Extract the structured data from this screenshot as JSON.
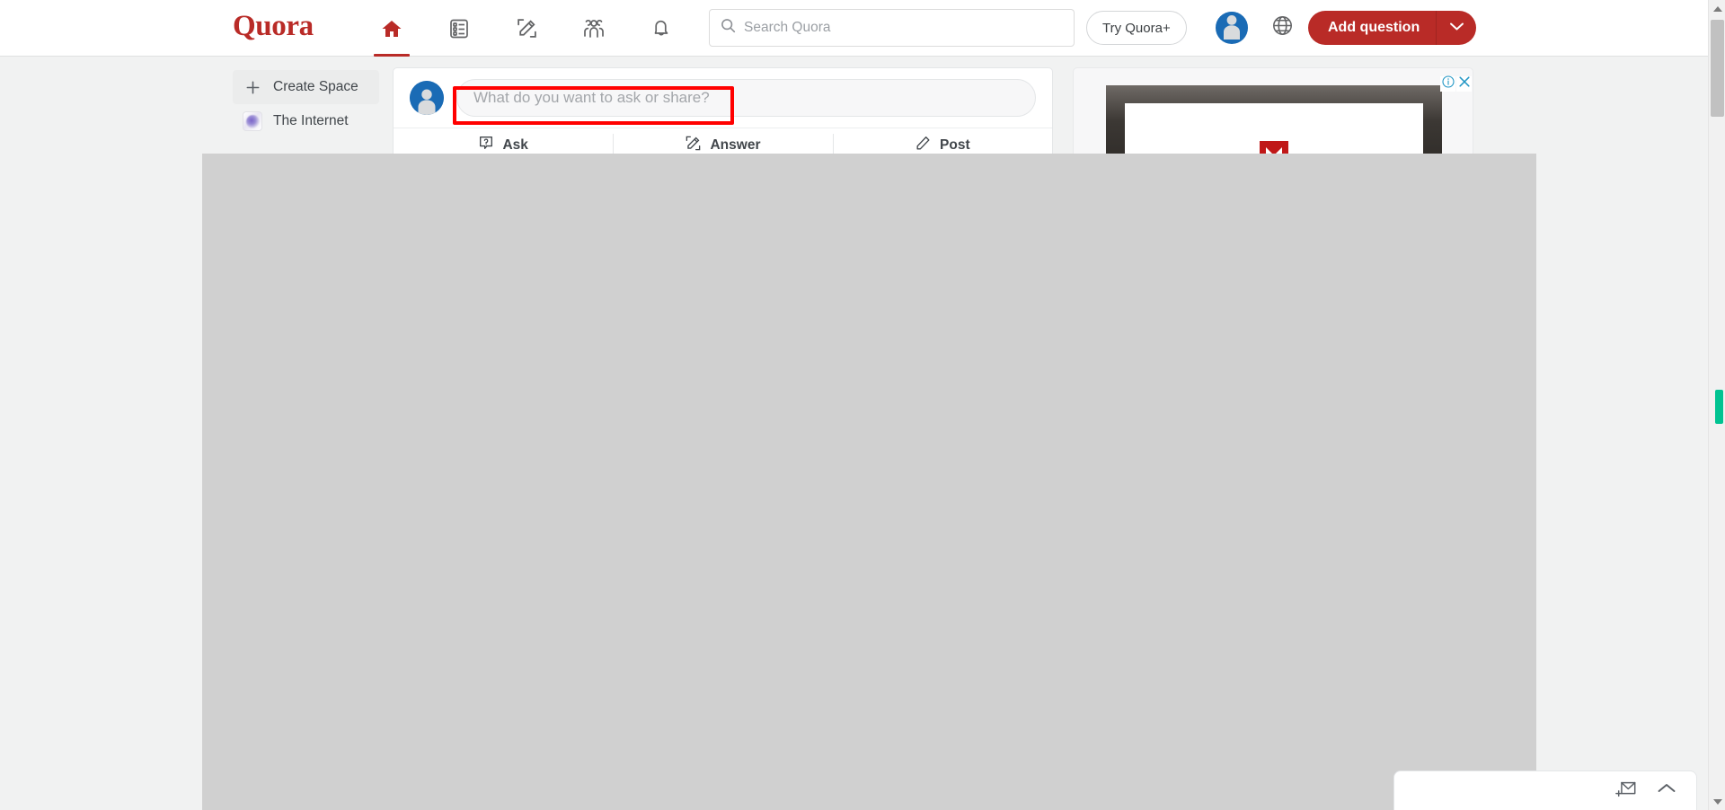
{
  "brand": {
    "name": "Quora",
    "primary_color": "#b92b27",
    "accent_color": "#1a6bb5",
    "highlight_color": "#ff0000",
    "scroll_marker_color": "#00c391"
  },
  "header": {
    "logo_text": "Quora",
    "nav": [
      {
        "name": "home",
        "icon": "home-icon",
        "active": true
      },
      {
        "name": "following",
        "icon": "list-feed-icon",
        "active": false
      },
      {
        "name": "answer",
        "icon": "pencil-square-icon",
        "active": false
      },
      {
        "name": "spaces",
        "icon": "people-group-icon",
        "active": false
      },
      {
        "name": "notifications",
        "icon": "bell-icon",
        "active": false
      }
    ],
    "search": {
      "placeholder": "Search Quora",
      "value": "",
      "icon": "search-icon"
    },
    "try_plus_label": "Try Quora+",
    "avatar_icon": "user-avatar-icon",
    "language_icon": "globe-icon",
    "add_question": {
      "label": "Add question",
      "chevron_icon": "chevron-down-icon"
    }
  },
  "sidebar": {
    "items": [
      {
        "label": "Create Space",
        "icon": "plus-icon",
        "shaded": true
      },
      {
        "label": "The Internet",
        "icon": "space-thumbnail-icon",
        "shaded": false
      }
    ]
  },
  "composer": {
    "avatar_icon": "user-avatar-icon",
    "input_placeholder": "What do you want to ask or share?",
    "input_value": "",
    "tabs": [
      {
        "label": "Ask",
        "icon": "question-box-icon"
      },
      {
        "label": "Answer",
        "icon": "pencil-square-icon"
      },
      {
        "label": "Post",
        "icon": "pencil-icon"
      }
    ]
  },
  "ad": {
    "brand_icon": "mcafee-shield-icon",
    "adchoices_icon": "info-circle-icon",
    "close_icon": "close-x-icon"
  },
  "messaging": {
    "new_message_icon": "new-message-envelope-icon",
    "expand_icon": "chevron-up-icon"
  },
  "scrollbar": {
    "up_icon": "triangle-up-icon",
    "down_icon": "triangle-down-icon",
    "thumb": "scrollbar-thumb"
  }
}
